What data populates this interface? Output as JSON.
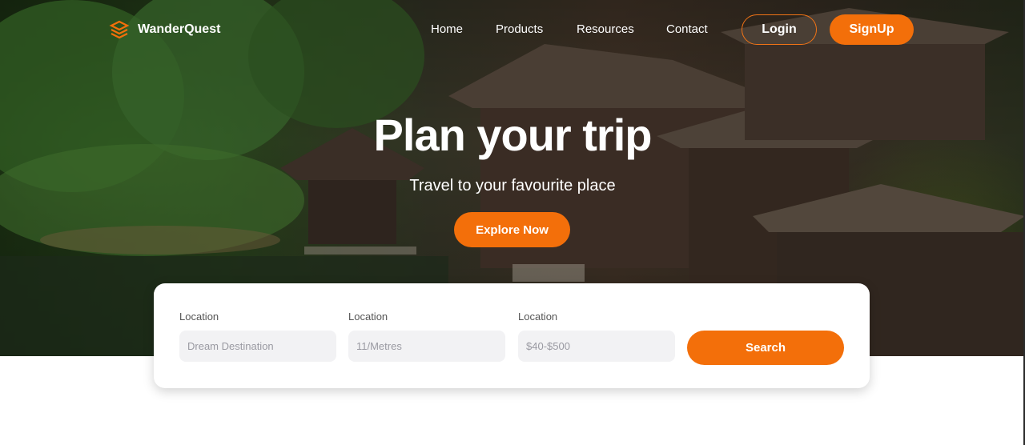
{
  "brand": {
    "name": "WanderQuest",
    "icon": "layers-logo-icon",
    "accent": "#f36f0a"
  },
  "nav": {
    "links": [
      "Home",
      "Products",
      "Resources",
      "Contact"
    ],
    "login": "Login",
    "signup": "SignUp"
  },
  "hero": {
    "title": "Plan your trip",
    "subtitle": "Travel to your favourite place",
    "cta": "Explore Now"
  },
  "search": {
    "fields": [
      {
        "label": "Location",
        "placeholder": "Dream Destination"
      },
      {
        "label": "Location",
        "placeholder": "11/Metres"
      },
      {
        "label": "Location",
        "placeholder": "$40-$500"
      }
    ],
    "button": "Search"
  }
}
